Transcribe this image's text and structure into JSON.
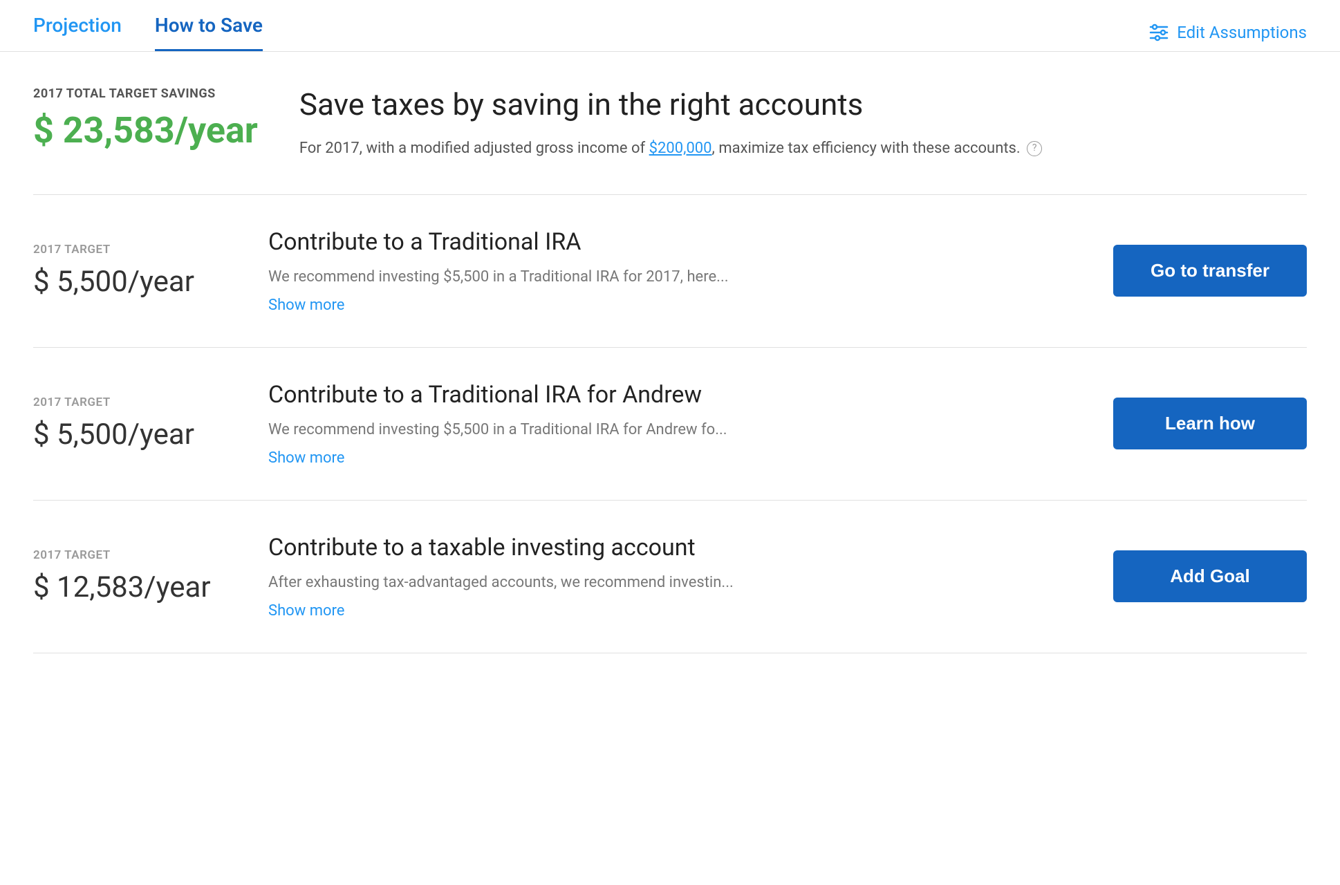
{
  "tabs": [
    {
      "id": "projection",
      "label": "Projection",
      "active": false
    },
    {
      "id": "how-to-save",
      "label": "How to Save",
      "active": true
    }
  ],
  "header": {
    "edit_assumptions_label": "Edit Assumptions"
  },
  "top_section": {
    "target_label": "2017 TOTAL TARGET SAVINGS",
    "target_amount": "$ 23,583/year",
    "title": "Save taxes by saving in the right accounts",
    "description_pre": "For 2017, with a modified adjusted gross income of ",
    "description_amount": "$200,000",
    "description_post": ", maximize tax efficiency with these accounts.",
    "info_icon": "?"
  },
  "recommendations": [
    {
      "target_label": "2017 TARGET",
      "target_amount": "$ 5,500/year",
      "title": "Contribute to a Traditional IRA",
      "description": "We recommend investing $5,500 in a Traditional IRA for 2017, here...",
      "show_more": "Show more",
      "action_label": "Go to transfer"
    },
    {
      "target_label": "2017 TARGET",
      "target_amount": "$ 5,500/year",
      "title": "Contribute to a Traditional IRA for Andrew",
      "description": "We recommend investing $5,500 in a Traditional IRA for Andrew fo...",
      "show_more": "Show more",
      "action_label": "Learn how"
    },
    {
      "target_label": "2017 TARGET",
      "target_amount": "$ 12,583/year",
      "title": "Contribute to a taxable investing account",
      "description": "After exhausting tax-advantaged accounts, we recommend investin...",
      "show_more": "Show more",
      "action_label": "Add Goal"
    }
  ]
}
